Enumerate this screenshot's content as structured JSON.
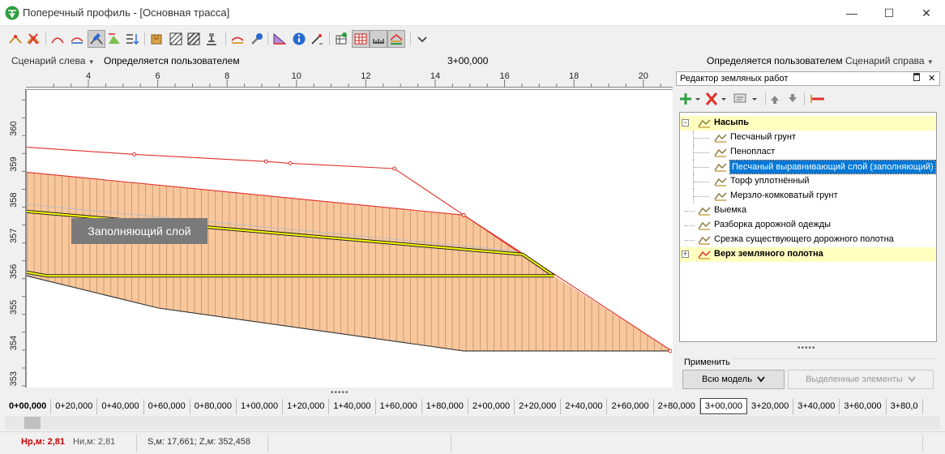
{
  "window": {
    "title": "Поперечный профиль - [Основная трасса]",
    "minimize_glyph": "—",
    "maximize_glyph": "☐",
    "close_glyph": "✕"
  },
  "toolbar": {
    "icons": [
      "point-add-icon",
      "point-delete-icon",
      "arc-icon",
      "arc-top-icon",
      "profile-edit-icon",
      "slope-icon",
      "stack-icon",
      "box-icon",
      "hatch-icon",
      "hatch-alt-icon",
      "anchor-icon",
      "layer-icon",
      "tools-icon",
      "triangle-icon",
      "info-icon",
      "measure-icon",
      "table-icon",
      "grid-icon",
      "ruler-icon",
      "layers-icon",
      "more-icon"
    ]
  },
  "scenario": {
    "left_label": "Сценарий слева",
    "left_value": "Определяется пользователем",
    "station": "3+00,000",
    "right_value": "Определяется пользователем",
    "right_label": "Сценарий справа"
  },
  "axes": {
    "x_ticks": [
      "4",
      "6",
      "8",
      "10",
      "12",
      "14",
      "16",
      "18",
      "20"
    ],
    "y_ticks": [
      "360",
      "359",
      "358",
      "357",
      "356",
      "355",
      "354",
      "353"
    ]
  },
  "chart_data": {
    "type": "area",
    "x_range": [
      2.2,
      20.8
    ],
    "y_range": [
      352.8,
      361.1
    ],
    "design_line": {
      "color": "#e0302a",
      "points": [
        [
          2.2,
          359.5
        ],
        [
          5.3,
          359.3
        ],
        [
          9.1,
          359.1
        ],
        [
          9.8,
          359.05
        ],
        [
          12.8,
          358.9
        ],
        [
          14.8,
          357.6
        ],
        [
          20.8,
          353.8
        ]
      ]
    },
    "fill_top": {
      "color": "#e0302a",
      "points": [
        [
          2.2,
          358.8
        ],
        [
          14.8,
          357.6
        ],
        [
          17.4,
          355.9
        ]
      ]
    },
    "ground_line": {
      "color": "#333333",
      "points": [
        [
          2.2,
          355.9
        ],
        [
          6.0,
          355.0
        ],
        [
          14.8,
          353.8
        ],
        [
          20.8,
          353.8
        ]
      ]
    },
    "layer_top": {
      "color": "#ffff00",
      "points": [
        [
          2.2,
          357.7
        ],
        [
          16.5,
          356.5
        ],
        [
          17.4,
          355.9
        ]
      ]
    },
    "layer_bottom": {
      "color": "#ffff00",
      "points": [
        [
          2.2,
          356.0
        ],
        [
          2.8,
          355.9
        ],
        [
          17.4,
          355.9
        ]
      ]
    },
    "fill_color": "#f9c79c",
    "annotation": "Заполняющий слой"
  },
  "panel": {
    "title": "Редактор земляных работ",
    "pin_glyph": "📌",
    "close_glyph": "✕",
    "tree": [
      {
        "label": "Насыпь",
        "bold": true,
        "level": 0,
        "expander": "−",
        "highlight": true
      },
      {
        "label": "Песчаный грунт",
        "level": 1
      },
      {
        "label": "Пенопласт",
        "level": 1
      },
      {
        "label": "Песчаный выравнивающий слой (заполняющий)",
        "level": 1,
        "selected": true
      },
      {
        "label": "Торф уплотнённый",
        "level": 1
      },
      {
        "label": "Мерзло-комковатый грунт",
        "level": 1
      },
      {
        "label": "Выемка",
        "level": 0
      },
      {
        "label": "Разборка дорожной одежды",
        "level": 0
      },
      {
        "label": "Срезка существующего дорожного полотна",
        "level": 0
      },
      {
        "label": "Верх земляного полотна",
        "bold": true,
        "level": 0,
        "expander": "+",
        "highlight": true
      }
    ],
    "apply_label": "Применить",
    "apply_all": "Всю модель",
    "apply_selected": "Выделенные элементы"
  },
  "stations": [
    "0+00,000",
    "0+20,000",
    "0+40,000",
    "0+60,000",
    "0+80,000",
    "1+00,000",
    "1+20,000",
    "1+40,000",
    "1+60,000",
    "1+80,000",
    "2+00,000",
    "2+20,000",
    "2+40,000",
    "2+60,000",
    "2+80,000",
    "3+00,000",
    "3+20,000",
    "3+40,000",
    "3+60,000",
    "3+80,0"
  ],
  "status": {
    "hr": "Нр,м: 2,81",
    "hn": "Ни,м: 2,81",
    "coords": "S,м: 17,661;  Z,м: 352,458"
  },
  "colors": {
    "accent": "#0078d7",
    "red": "#e0302a",
    "highlight": "#ffffc0"
  }
}
